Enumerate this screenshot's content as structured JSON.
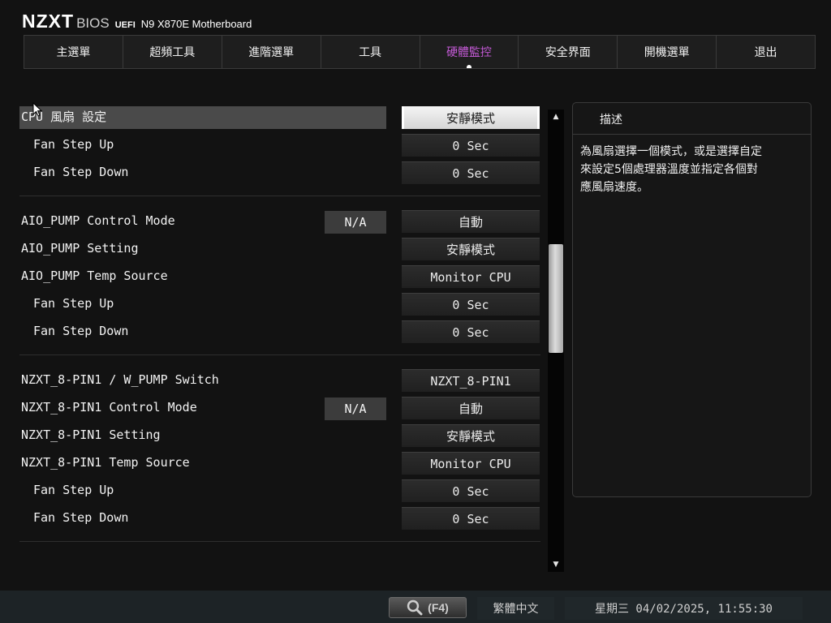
{
  "header": {
    "logo": "NZXT",
    "bios": "BIOS",
    "uefi": "UEFI",
    "model": "N9 X870E Motherboard"
  },
  "tabs": [
    {
      "label": "主選單",
      "active": false
    },
    {
      "label": "超頻工具",
      "active": false
    },
    {
      "label": "進階選單",
      "active": false
    },
    {
      "label": "工具",
      "active": false
    },
    {
      "label": "硬體監控",
      "active": true
    },
    {
      "label": "安全界面",
      "active": false
    },
    {
      "label": "開機選單",
      "active": false
    },
    {
      "label": "退出",
      "active": false
    }
  ],
  "groups": [
    {
      "rows": [
        {
          "label": "CPU 風扇 設定",
          "value": "安靜模式",
          "indent": false,
          "highlight": true,
          "na": ""
        },
        {
          "label": "Fan Step Up",
          "value": "0 Sec",
          "indent": true,
          "highlight": false,
          "na": ""
        },
        {
          "label": "Fan Step Down",
          "value": "0 Sec",
          "indent": true,
          "highlight": false,
          "na": ""
        }
      ]
    },
    {
      "rows": [
        {
          "label": "AIO_PUMP Control Mode",
          "value": "自動",
          "indent": false,
          "highlight": false,
          "na": "N/A"
        },
        {
          "label": "AIO_PUMP Setting",
          "value": "安靜模式",
          "indent": false,
          "highlight": false,
          "na": ""
        },
        {
          "label": "AIO_PUMP Temp Source",
          "value": "Monitor CPU",
          "indent": false,
          "highlight": false,
          "na": ""
        },
        {
          "label": "Fan Step Up",
          "value": "0 Sec",
          "indent": true,
          "highlight": false,
          "na": ""
        },
        {
          "label": "Fan Step Down",
          "value": "0 Sec",
          "indent": true,
          "highlight": false,
          "na": ""
        }
      ]
    },
    {
      "rows": [
        {
          "label": "NZXT_8-PIN1 / W_PUMP Switch",
          "value": "NZXT_8-PIN1",
          "indent": false,
          "highlight": false,
          "na": ""
        },
        {
          "label": "NZXT_8-PIN1 Control Mode",
          "value": "自動",
          "indent": false,
          "highlight": false,
          "na": "N/A"
        },
        {
          "label": "NZXT_8-PIN1 Setting",
          "value": "安靜模式",
          "indent": false,
          "highlight": false,
          "na": ""
        },
        {
          "label": "NZXT_8-PIN1 Temp Source",
          "value": "Monitor CPU",
          "indent": false,
          "highlight": false,
          "na": ""
        },
        {
          "label": "Fan Step Up",
          "value": "0 Sec",
          "indent": true,
          "highlight": false,
          "na": ""
        },
        {
          "label": "Fan Step Down",
          "value": "0 Sec",
          "indent": true,
          "highlight": false,
          "na": ""
        }
      ]
    }
  ],
  "scroll": {
    "position": 0.37
  },
  "description": {
    "title": "描述",
    "lines": [
      "為風扇選擇一個模式，或是選擇自定",
      "來設定5個處理器溫度並指定各個對",
      "應風扇速度。"
    ]
  },
  "footer": {
    "search_key": "(F4)",
    "language": "繁體中文",
    "datetime": "星期三 04/02/2025, 11:55:30"
  },
  "icons": {
    "search": "magnifier-icon",
    "scroll_up": "triangle-up-icon",
    "scroll_down": "triangle-down-icon",
    "cursor": "mouse-pointer-icon"
  },
  "colors": {
    "active_tab": "#c45ad6",
    "background": "#121212",
    "footer": "#1d2326"
  }
}
